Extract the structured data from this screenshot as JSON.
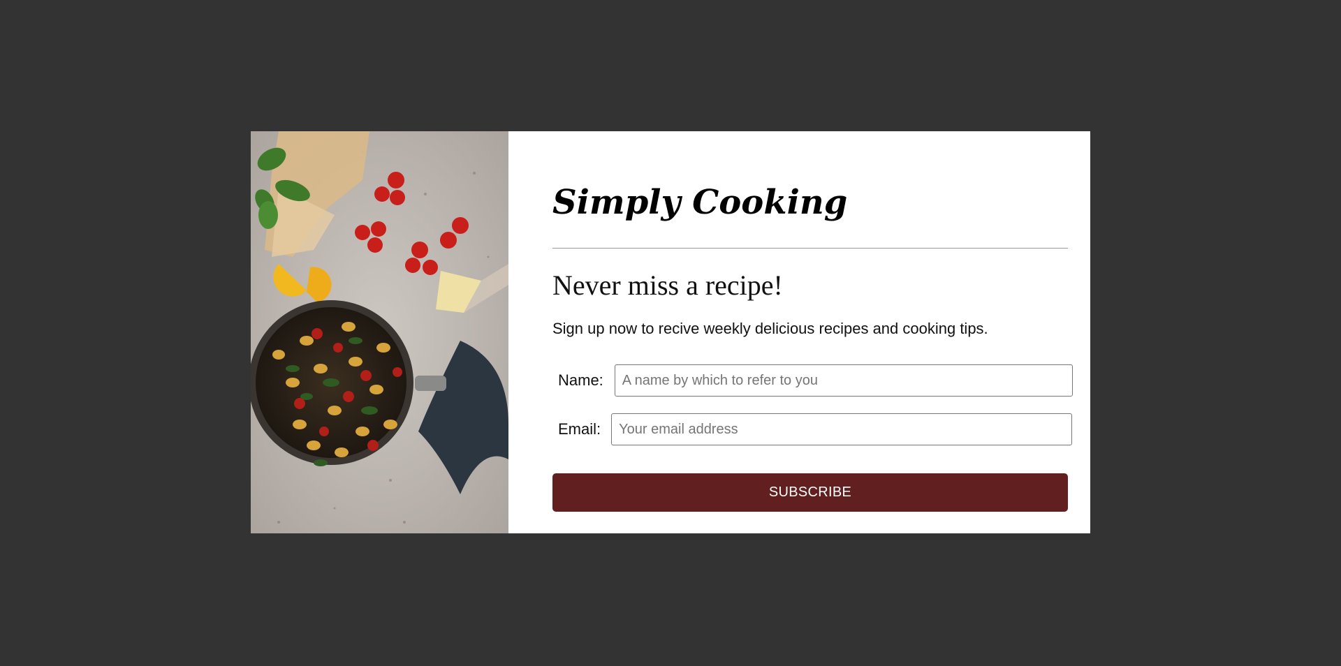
{
  "brand": {
    "title": "Simply Cooking"
  },
  "signup": {
    "headline": "Never miss a recipe!",
    "subtext": "Sign up now to recive weekly delicious recipes and cooking tips.",
    "name_label": "Name:",
    "name_placeholder": "A name by which to refer to you",
    "name_value": "",
    "email_label": "Email:",
    "email_placeholder": "Your email address",
    "email_value": "",
    "subscribe_label": "SUBSCRIBE"
  },
  "colors": {
    "backdrop": "#333333",
    "card": "#ffffff",
    "button": "#621f20",
    "button_text": "#ffffff"
  },
  "image": {
    "description_icon": "food-photo"
  }
}
